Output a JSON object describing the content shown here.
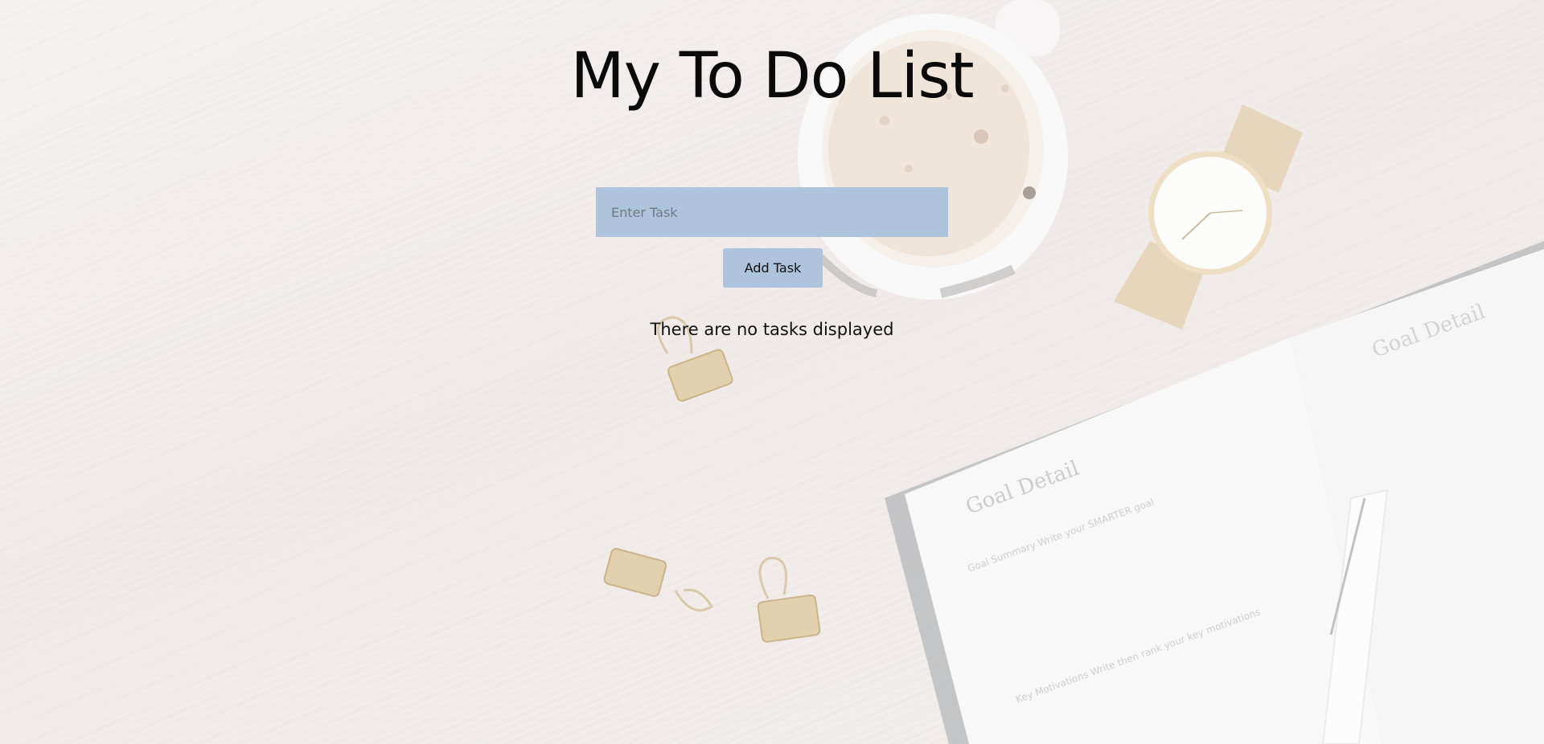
{
  "page": {
    "title": "My To Do List"
  },
  "task_form": {
    "input_placeholder": "Enter Task",
    "input_value": "",
    "add_button_label": "Add Task"
  },
  "task_list": {
    "empty_message": "There are no tasks displayed",
    "items": []
  },
  "colors": {
    "accent": "#aec3dc",
    "text": "#0a0a0a",
    "background": "#ece6e3"
  }
}
